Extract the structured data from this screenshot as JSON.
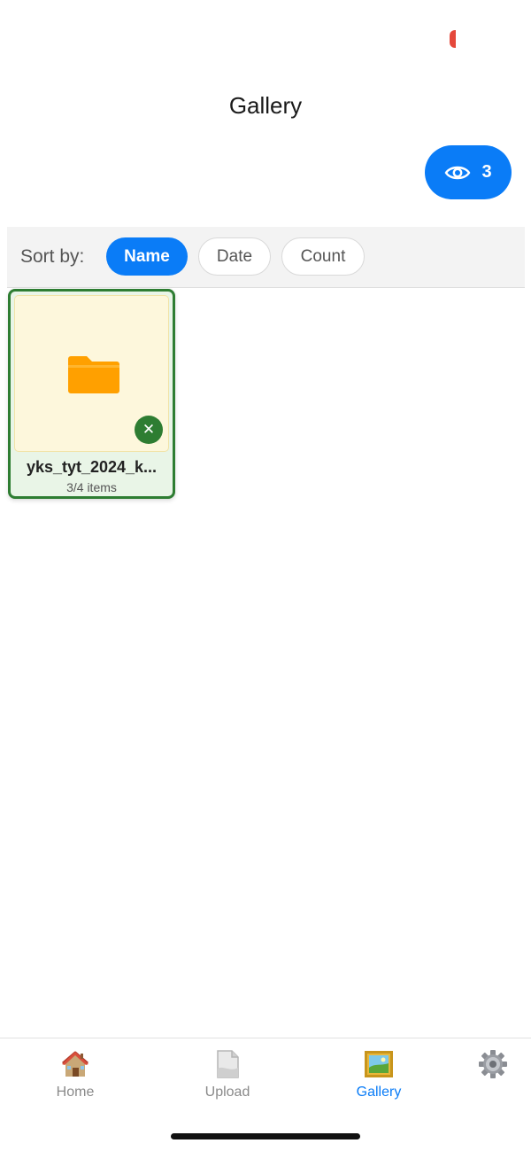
{
  "header": {
    "title": "Gallery",
    "view_count": "3",
    "view_icon": "eye-icon"
  },
  "sort": {
    "label": "Sort by:",
    "options": [
      "Name",
      "Date",
      "Count"
    ],
    "selected": "Name"
  },
  "folders": [
    {
      "name": "yks_tyt_2024_k...",
      "count": "3/4 items",
      "icon": "folder-icon",
      "badge_icon": "close-icon",
      "badge_symbol": "✕",
      "selected": true
    }
  ],
  "tabbar": {
    "items": [
      {
        "label": "Home",
        "icon": "house-icon",
        "active": false
      },
      {
        "label": "Upload",
        "icon": "document-icon",
        "active": false
      },
      {
        "label": "Gallery",
        "icon": "framed-picture-icon",
        "active": true
      },
      {
        "label": "",
        "icon": "gear-icon",
        "active": false
      }
    ]
  },
  "colors": {
    "accent": "#0a7cf7",
    "selected_border": "#2e7d32",
    "folder": "#ffa000",
    "status_mark": "#e5483b"
  }
}
